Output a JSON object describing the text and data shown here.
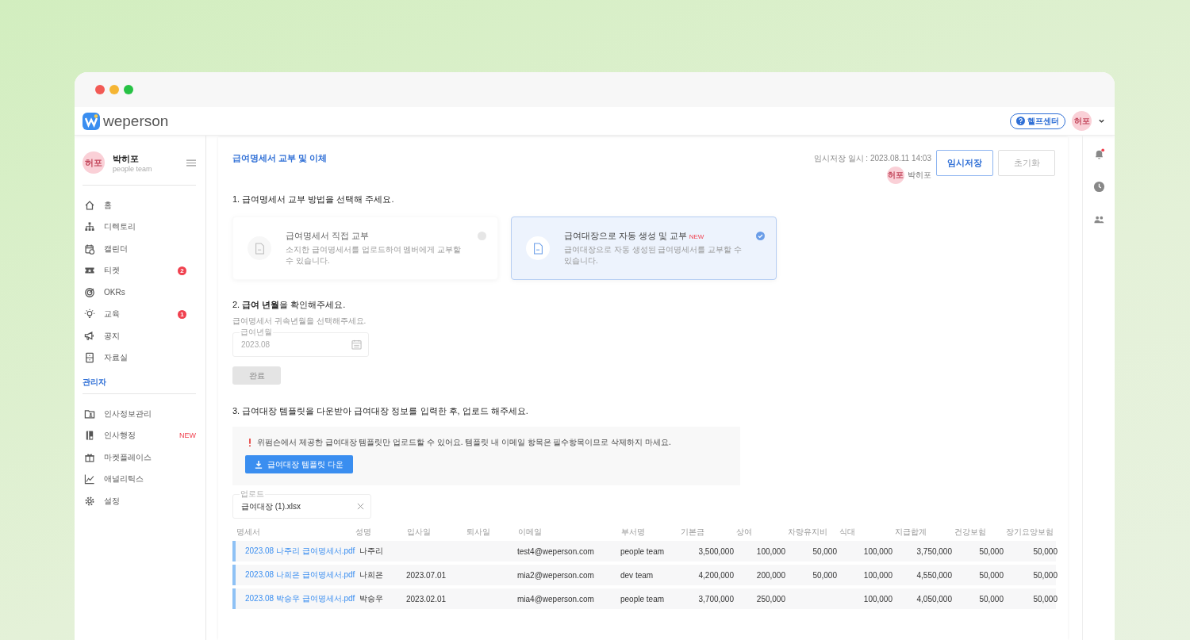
{
  "header": {
    "logo": "weperson",
    "help": "헬프센터",
    "avatar": "허포"
  },
  "sidebar": {
    "profile": {
      "avatar": "허포",
      "name": "박히포",
      "team": "people team"
    },
    "items": [
      {
        "label": "홈",
        "kind": "home"
      },
      {
        "label": "디렉토리",
        "kind": "org"
      },
      {
        "label": "캘린더",
        "kind": "calendar"
      },
      {
        "label": "티켓",
        "kind": "ticket",
        "badge": "2"
      },
      {
        "label": "OKRs",
        "kind": "target"
      },
      {
        "label": "교육",
        "kind": "bulb",
        "badge": "1"
      },
      {
        "label": "공지",
        "kind": "megaphone"
      },
      {
        "label": "자료실",
        "kind": "cabinet"
      }
    ],
    "admin_title": "관리자",
    "admin_items": [
      {
        "label": "인사정보관리",
        "kind": "idcard"
      },
      {
        "label": "인사행정",
        "kind": "binder",
        "tag": "NEW"
      },
      {
        "label": "마켓플레이스",
        "kind": "gift"
      },
      {
        "label": "애널리틱스",
        "kind": "chart"
      },
      {
        "label": "설정",
        "kind": "gear"
      }
    ]
  },
  "page": {
    "title": "급여명세서 교부 및 이체",
    "saved_at": "임시저장 일시 : 2023.08.11 14:03",
    "saver_avatar": "허포",
    "saver": "박히포",
    "save_button": "임시저장",
    "reset_button": "초기화"
  },
  "step1": {
    "heading": "1. 급여명세서 교부 방법을 선택해 주세요.",
    "options": [
      {
        "title": "급여명세서 직접 교부",
        "desc": "소지한 급여명세서를 업로드하여 멤버에게 교부할 수 있습니다.",
        "selected": false
      },
      {
        "title": "급여대장으로 자동 생성 및 교부",
        "tag": "NEW",
        "desc": "급여대장으로 자동 생성된 급여명세서를 교부할 수 있습니다.",
        "selected": true
      }
    ]
  },
  "step2": {
    "heading": "2. **급여 년월**을 확인해주세요.",
    "hint": "급여명세서 귀속년월을 선택해주세요.",
    "field_label": "급여년월",
    "value": "2023.08",
    "disabled": true,
    "button": "완료",
    "button_disabled": true
  },
  "step3": {
    "heading": "3. 급여대장 템플릿을 다운받아 급여대장 정보를 입력한 후, 업로드 해주세요.",
    "notice": "위펌슨에서 제공한 급여대장 템플릿만 업로드할 수 있어요. 템플릿 내 이메일 항목은 필수항목이므로 삭제하지 마세요.",
    "download_button": "급여대장 템플릿 다운",
    "upload_label": "업로드",
    "upload_value": "급여대장 (1).xlsx"
  },
  "table": {
    "columns": [
      "명세서",
      "성명",
      "입사일",
      "퇴사일",
      "이메일",
      "부서명",
      "기본금",
      "상여",
      "차량유지비",
      "식대",
      "지급합계",
      "건강보험",
      "장기요양보험"
    ],
    "rows": [
      [
        "2023.08 나주리 급여명세서.pdf",
        "나주리",
        "",
        "",
        "test4@weperson.com",
        "people team",
        "3,500,000",
        "100,000",
        "50,000",
        "100,000",
        "3,750,000",
        "50,000",
        "50,000"
      ],
      [
        "2023.08 나희은 급여명세서.pdf",
        "나희은",
        "2023.07.01",
        "",
        "mia2@weperson.com",
        "dev team",
        "4,200,000",
        "200,000",
        "50,000",
        "100,000",
        "4,550,000",
        "50,000",
        "50,000"
      ],
      [
        "2023.08 박승우 급여명세서.pdf",
        "박승우",
        "2023.02.01",
        "",
        "mia4@weperson.com",
        "people team",
        "3,700,000",
        "250,000",
        "",
        "100,000",
        "4,050,000",
        "50,000",
        "50,000"
      ]
    ]
  }
}
